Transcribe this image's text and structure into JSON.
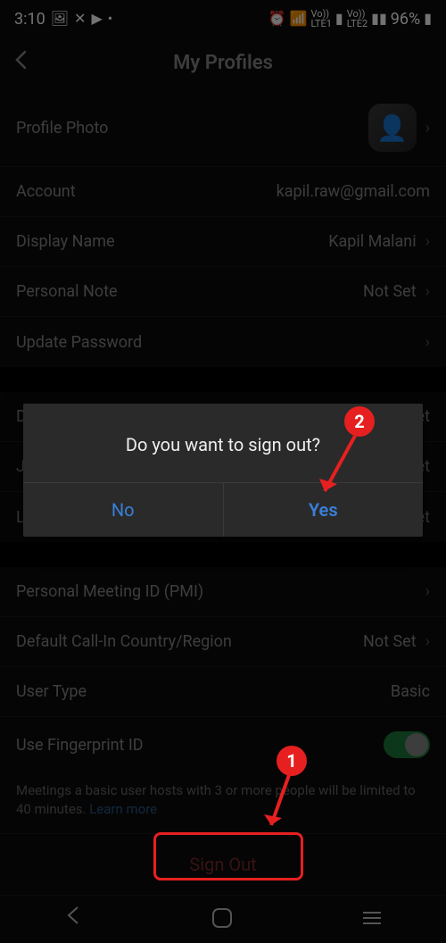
{
  "status": {
    "time": "3:10",
    "battery_pct": "96%",
    "sim1": "LTE1",
    "sim2": "LTE2"
  },
  "header": {
    "title": "My Profiles"
  },
  "rows": {
    "profile_photo": "Profile Photo",
    "account_label": "Account",
    "account_value": "kapil.raw@gmail.com",
    "display_name_label": "Display Name",
    "display_name_value": "Kapil Malani",
    "personal_note_label": "Personal Note",
    "personal_note_value": "Not Set",
    "update_password_label": "Update Password",
    "department_label": "Depa",
    "department_value": "et",
    "job_label": "Job",
    "job_value": "et",
    "location_label": "Loca",
    "location_value": "et",
    "pmi_label": "Personal Meeting ID (PMI)",
    "callin_label": "Default Call-In Country/Region",
    "callin_value": "Not Set",
    "user_type_label": "User Type",
    "user_type_value": "Basic",
    "fingerprint_label": "Use Fingerprint ID"
  },
  "note": {
    "text": "Meetings a basic user hosts with 3 or more people will be limited to 40 minutes. ",
    "link": "Learn more"
  },
  "signout_label": "Sign Out",
  "dialog": {
    "text": "Do you want to sign out?",
    "no": "No",
    "yes": "Yes"
  },
  "annotations": {
    "step1": "1",
    "step2": "2"
  }
}
